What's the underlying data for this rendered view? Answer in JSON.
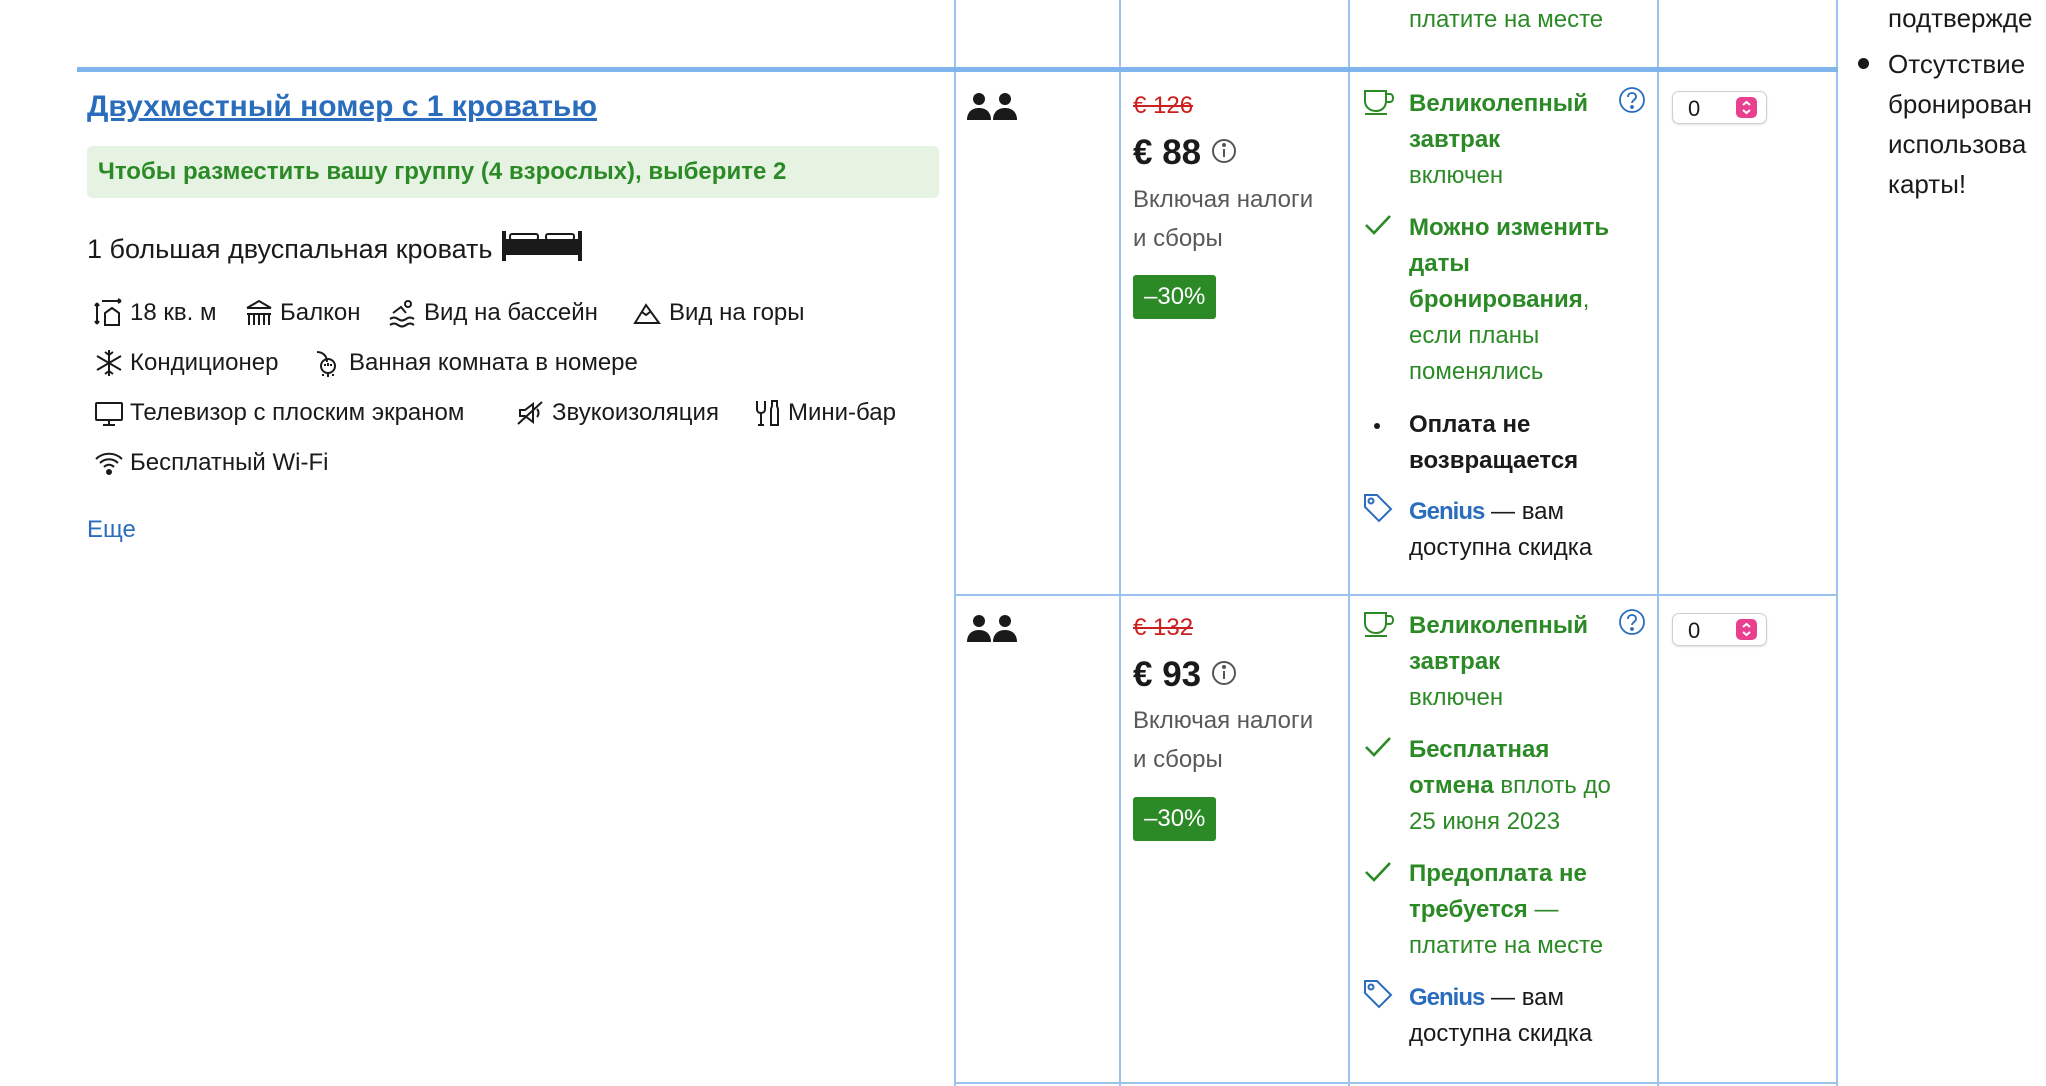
{
  "top_row": {
    "pay_text": "платите на месте"
  },
  "room": {
    "title": "Двухместный номер с 1 кроватью",
    "group_hint": "Чтобы разместить вашу группу (4 взрослых), выберите 2",
    "bed": "1 большая двуспальная кровать",
    "facilities": [
      {
        "label": "18 кв. м",
        "icon": "room-size-icon"
      },
      {
        "label": "Балкон",
        "icon": "balcony-icon"
      },
      {
        "label": "Вид на бассейн",
        "icon": "pool-icon"
      },
      {
        "label": "Вид на горы",
        "icon": "mountain-icon"
      },
      {
        "label": "Кондиционер",
        "icon": "snowflake-icon"
      },
      {
        "label": "Ванная комната в номере",
        "icon": "shower-icon"
      },
      {
        "label": "Телевизор с плоским экраном",
        "icon": "tv-icon"
      },
      {
        "label": "Звукоизоляция",
        "icon": "soundproof-icon"
      },
      {
        "label": "Мини-бар",
        "icon": "minibar-icon"
      },
      {
        "label": "Бесплатный Wi-Fi",
        "icon": "wifi-icon"
      }
    ],
    "more_link": "Еще"
  },
  "options": [
    {
      "old_price": "€ 126",
      "price": "€ 88",
      "tax": [
        "Включая налоги",
        "и сборы"
      ],
      "discount": "–30%",
      "breakfast": {
        "title_1": "Великолепный",
        "title_2": "завтрак",
        "sub": "включен"
      },
      "change": {
        "l1": "Можно изменить",
        "l2": "даты",
        "l3": "бронирования",
        "l3_tail": ",",
        "l4": "если планы",
        "l5": "поменялись"
      },
      "nonrefund": {
        "l1": "Оплата не",
        "l2": "возвращается"
      },
      "genius": {
        "brand": "Genius",
        "l1_tail": " — вам",
        "l2": "доступна скидка"
      },
      "qty": "0"
    },
    {
      "old_price": "€ 132",
      "price": "€ 93",
      "tax": [
        "Включая налоги",
        "и сборы"
      ],
      "discount": "–30%",
      "breakfast": {
        "title_1": "Великолепный",
        "title_2": "завтрак",
        "sub": "включен"
      },
      "cancel": {
        "l1": "Бесплатная",
        "l2_bold": "отмена",
        "l2_tail": " вплоть до",
        "l3": "25 июня 2023"
      },
      "prepay": {
        "l1": "Предоплата не",
        "l2_bold": "требуется",
        "l2_tail": " —",
        "l3": "платите на месте"
      },
      "genius": {
        "brand": "Genius",
        "l1_tail": " — вам",
        "l2": "доступна скидка"
      },
      "qty": "0"
    }
  ],
  "side": {
    "line0": "подтвержде",
    "bullet_lines": [
      "Отсутствие",
      "бронирован",
      "использова",
      "карты!"
    ]
  },
  "colors": {
    "accent_blue": "#2b6dbd",
    "green": "#2b8a26",
    "strike_red": "#cc1f1f",
    "grid_blue": "#9cc3ee",
    "select_pink": "#e8408f"
  }
}
